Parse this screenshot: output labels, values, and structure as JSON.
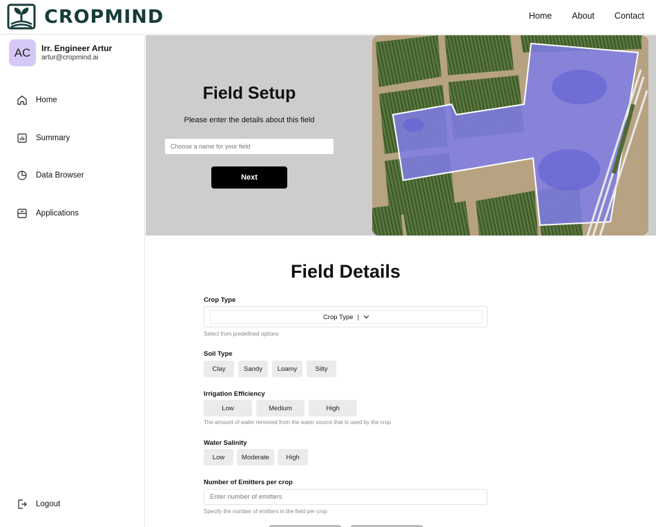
{
  "brand": {
    "name": "CROPMIND",
    "color": "#163b3a"
  },
  "topnav": {
    "items": [
      "Home",
      "About",
      "Contact"
    ]
  },
  "user": {
    "initials": "AC",
    "name": "Irr. Engineer Artur",
    "email": "artur@cropmind.ai",
    "avatar_color": "#d6c8f6"
  },
  "sidebar": {
    "items": [
      {
        "label": "Home",
        "icon": "home-icon"
      },
      {
        "label": "Summary",
        "icon": "summary-chart-icon"
      },
      {
        "label": "Data Browser",
        "icon": "pie-chart-icon"
      },
      {
        "label": "Applications",
        "icon": "applications-icon"
      }
    ],
    "logout": {
      "label": "Logout",
      "icon": "logout-icon"
    }
  },
  "hero": {
    "title": "Field Setup",
    "subtitle": "Please enter the details about this field",
    "input_placeholder": "Choose a name for your field",
    "next_label": "Next",
    "background": "#cdcdcd"
  },
  "details": {
    "title": "Field Details",
    "crop_type": {
      "label": "Crop Type",
      "value": "Crop Type",
      "help": "Select from predefined options"
    },
    "soil_type": {
      "label": "Soil Type",
      "options": [
        "Clay",
        "Sandy",
        "Loamy",
        "Silty"
      ]
    },
    "irrigation": {
      "label": "Irrigation Efficiency",
      "options": [
        "Low",
        "Medium",
        "High"
      ],
      "help": "The amount of water removed from the water source that is used by the crop"
    },
    "salinity": {
      "label": "Water Salinity",
      "options": [
        "Low",
        "Moderate",
        "High"
      ]
    },
    "emitters": {
      "label": "Number of Emitters per crop",
      "placeholder": "Enter number of emitters",
      "help": "Specify the number of emitters in the field per crop"
    }
  }
}
